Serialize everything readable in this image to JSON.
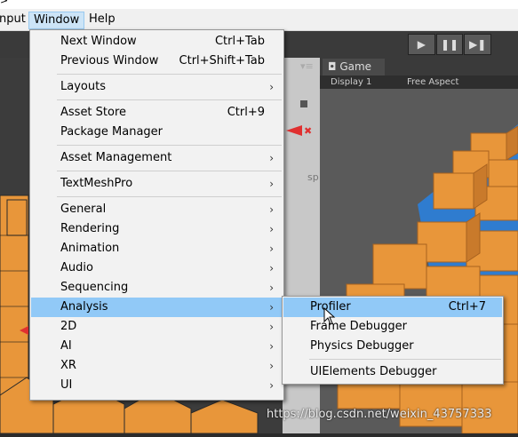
{
  "menubar": {
    "items": [
      "nput",
      "Window",
      "Help"
    ]
  },
  "playbar": {
    "play": "▶",
    "pause": "❚❚",
    "step": "▶❚"
  },
  "game": {
    "tab_label": "Game",
    "display": "Display 1",
    "aspect": "Free Aspect"
  },
  "inspector_fragment": "sp",
  "window_menu": {
    "items": [
      {
        "label": "Next Window",
        "shortcut": "Ctrl+Tab"
      },
      {
        "label": "Previous Window",
        "shortcut": "Ctrl+Shift+Tab"
      },
      {
        "label": "Layouts",
        "submenu": true
      },
      {
        "label": "Asset Store",
        "shortcut": "Ctrl+9"
      },
      {
        "label": "Package Manager"
      },
      {
        "label": "Asset Management",
        "submenu": true
      },
      {
        "label": "TextMeshPro",
        "submenu": true
      },
      {
        "label": "General",
        "submenu": true
      },
      {
        "label": "Rendering",
        "submenu": true
      },
      {
        "label": "Animation",
        "submenu": true
      },
      {
        "label": "Audio",
        "submenu": true
      },
      {
        "label": "Sequencing",
        "submenu": true
      },
      {
        "label": "Analysis",
        "submenu": true,
        "highlighted": true
      },
      {
        "label": "2D",
        "submenu": true
      },
      {
        "label": "AI",
        "submenu": true
      },
      {
        "label": "XR",
        "submenu": true
      },
      {
        "label": "UI",
        "submenu": true
      }
    ]
  },
  "analysis_submenu": {
    "items": [
      {
        "label": "Profiler",
        "shortcut": "Ctrl+7",
        "highlighted": true
      },
      {
        "label": "Frame Debugger"
      },
      {
        "label": "Physics Debugger"
      },
      {
        "label": "UIElements Debugger"
      }
    ]
  },
  "watermark": "https://blog.csdn.net/weixin_43757333",
  "colors": {
    "menu_highlight": "#91c9f7",
    "cube_orange": "#e8963a",
    "sky_blue": "#2f7ccf"
  }
}
